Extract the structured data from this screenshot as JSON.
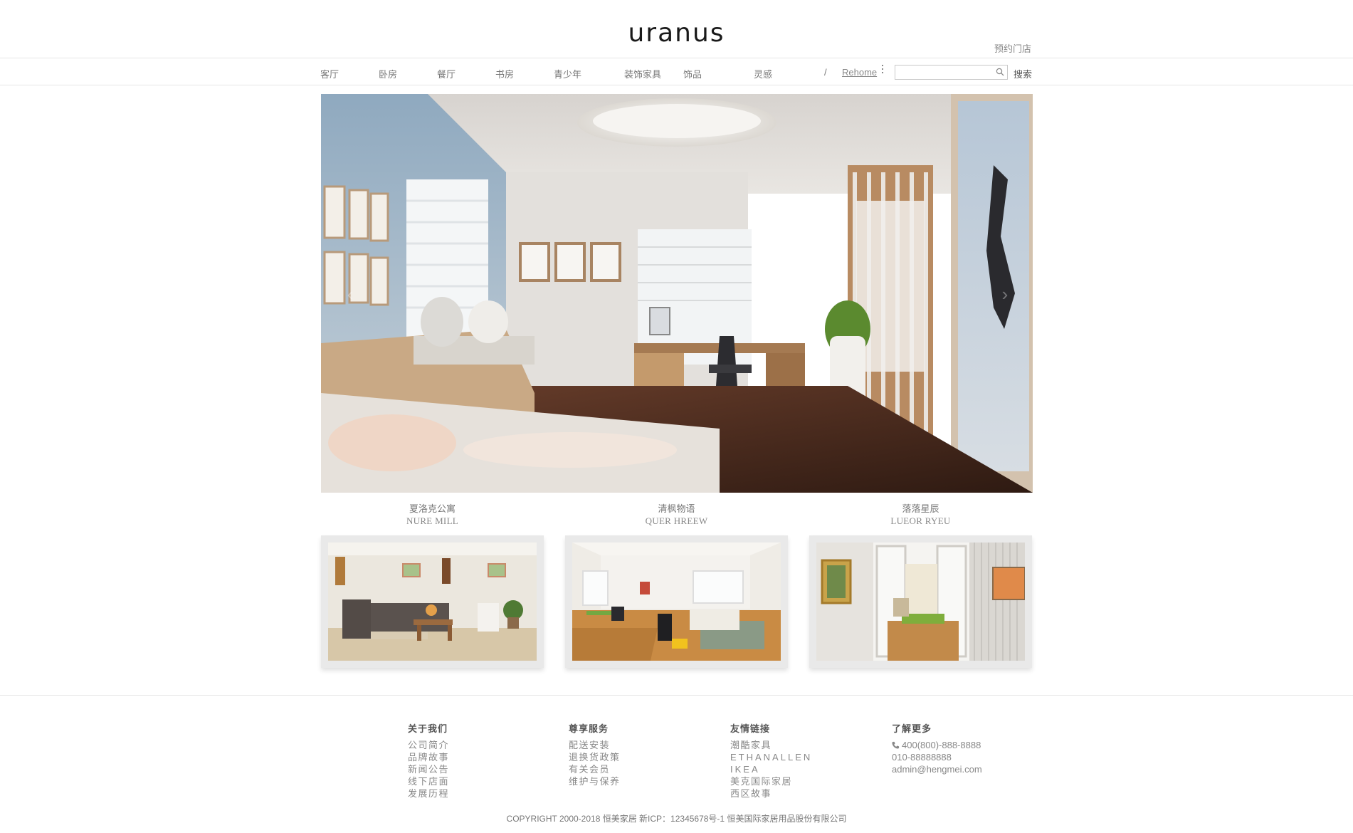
{
  "header": {
    "logo_text": "uranus",
    "store_link": "预约门店"
  },
  "nav": {
    "items": [
      "客厅",
      "卧房",
      "餐厅",
      "书房",
      "青少年",
      "装饰家具",
      "饰品",
      "灵感"
    ],
    "separator": "/",
    "brand": "Rehome",
    "search_placeholder": "",
    "search_button": "搜索"
  },
  "hero": {
    "image_icon": "bedroom-interior-photo",
    "prev_icon": "chevron-left-icon",
    "next_icon": "chevron-right-icon"
  },
  "features": [
    {
      "title": "夏洛克公寓",
      "subtitle": "NURE MILL",
      "image": "living-room-sofa-photo"
    },
    {
      "title": "清枫物语",
      "subtitle": "QUER HREEW",
      "image": "sunroom-living-photo"
    },
    {
      "title": "落落星辰",
      "subtitle": "LUEOR RYEU",
      "image": "sliding-door-room-photo"
    }
  ],
  "footer": {
    "columns": [
      {
        "heading": "关于我们",
        "links": [
          "公司简介",
          "品牌故事",
          "新闻公告",
          "线下店面",
          "发展历程"
        ]
      },
      {
        "heading": "尊享服务",
        "links": [
          "配送安装",
          "退换货政策",
          "有关会员",
          "维护与保养"
        ]
      },
      {
        "heading": "友情链接",
        "links": [
          "潮酷家具",
          "ETHANALLEN",
          "IKEA",
          "美克国际家居",
          "西区故事"
        ]
      },
      {
        "heading": "了解更多",
        "links": [
          "400(800)-888-8888",
          "010-88888888",
          "admin@hengmei.com"
        ]
      }
    ],
    "copyright": "COPYRIGHT 2000-2018 恒美家居 新ICP：12345678号-1 恒美国际家居用品股份有限公司"
  },
  "colors": {
    "background": "#ffffff",
    "text": "#666666",
    "border": "#e6e6e6"
  }
}
